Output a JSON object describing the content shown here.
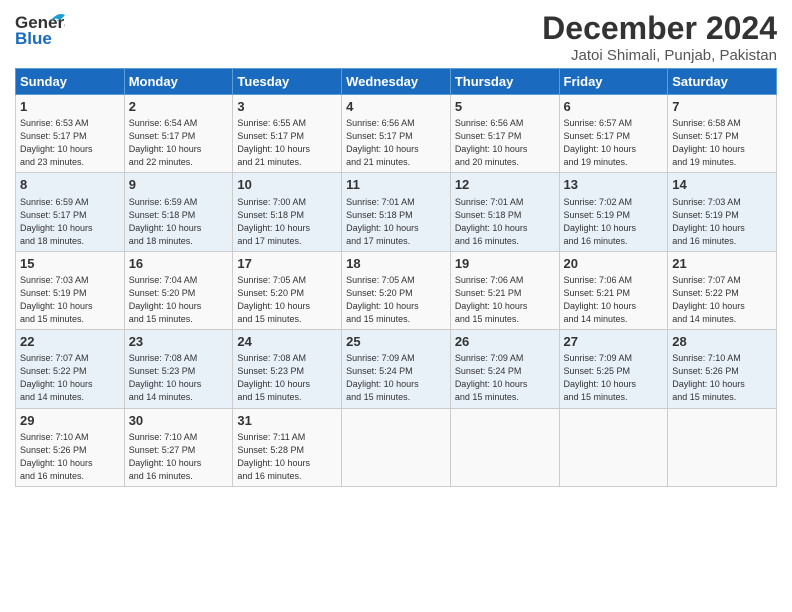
{
  "header": {
    "logo_line1": "General",
    "logo_line2": "Blue",
    "title": "December 2024",
    "subtitle": "Jatoi Shimali, Punjab, Pakistan"
  },
  "columns": [
    "Sunday",
    "Monday",
    "Tuesday",
    "Wednesday",
    "Thursday",
    "Friday",
    "Saturday"
  ],
  "weeks": [
    [
      {
        "day": "1",
        "info": "Sunrise: 6:53 AM\nSunset: 5:17 PM\nDaylight: 10 hours\nand 23 minutes."
      },
      {
        "day": "2",
        "info": "Sunrise: 6:54 AM\nSunset: 5:17 PM\nDaylight: 10 hours\nand 22 minutes."
      },
      {
        "day": "3",
        "info": "Sunrise: 6:55 AM\nSunset: 5:17 PM\nDaylight: 10 hours\nand 21 minutes."
      },
      {
        "day": "4",
        "info": "Sunrise: 6:56 AM\nSunset: 5:17 PM\nDaylight: 10 hours\nand 21 minutes."
      },
      {
        "day": "5",
        "info": "Sunrise: 6:56 AM\nSunset: 5:17 PM\nDaylight: 10 hours\nand 20 minutes."
      },
      {
        "day": "6",
        "info": "Sunrise: 6:57 AM\nSunset: 5:17 PM\nDaylight: 10 hours\nand 19 minutes."
      },
      {
        "day": "7",
        "info": "Sunrise: 6:58 AM\nSunset: 5:17 PM\nDaylight: 10 hours\nand 19 minutes."
      }
    ],
    [
      {
        "day": "8",
        "info": "Sunrise: 6:59 AM\nSunset: 5:17 PM\nDaylight: 10 hours\nand 18 minutes."
      },
      {
        "day": "9",
        "info": "Sunrise: 6:59 AM\nSunset: 5:18 PM\nDaylight: 10 hours\nand 18 minutes."
      },
      {
        "day": "10",
        "info": "Sunrise: 7:00 AM\nSunset: 5:18 PM\nDaylight: 10 hours\nand 17 minutes."
      },
      {
        "day": "11",
        "info": "Sunrise: 7:01 AM\nSunset: 5:18 PM\nDaylight: 10 hours\nand 17 minutes."
      },
      {
        "day": "12",
        "info": "Sunrise: 7:01 AM\nSunset: 5:18 PM\nDaylight: 10 hours\nand 16 minutes."
      },
      {
        "day": "13",
        "info": "Sunrise: 7:02 AM\nSunset: 5:19 PM\nDaylight: 10 hours\nand 16 minutes."
      },
      {
        "day": "14",
        "info": "Sunrise: 7:03 AM\nSunset: 5:19 PM\nDaylight: 10 hours\nand 16 minutes."
      }
    ],
    [
      {
        "day": "15",
        "info": "Sunrise: 7:03 AM\nSunset: 5:19 PM\nDaylight: 10 hours\nand 15 minutes."
      },
      {
        "day": "16",
        "info": "Sunrise: 7:04 AM\nSunset: 5:20 PM\nDaylight: 10 hours\nand 15 minutes."
      },
      {
        "day": "17",
        "info": "Sunrise: 7:05 AM\nSunset: 5:20 PM\nDaylight: 10 hours\nand 15 minutes."
      },
      {
        "day": "18",
        "info": "Sunrise: 7:05 AM\nSunset: 5:20 PM\nDaylight: 10 hours\nand 15 minutes."
      },
      {
        "day": "19",
        "info": "Sunrise: 7:06 AM\nSunset: 5:21 PM\nDaylight: 10 hours\nand 15 minutes."
      },
      {
        "day": "20",
        "info": "Sunrise: 7:06 AM\nSunset: 5:21 PM\nDaylight: 10 hours\nand 14 minutes."
      },
      {
        "day": "21",
        "info": "Sunrise: 7:07 AM\nSunset: 5:22 PM\nDaylight: 10 hours\nand 14 minutes."
      }
    ],
    [
      {
        "day": "22",
        "info": "Sunrise: 7:07 AM\nSunset: 5:22 PM\nDaylight: 10 hours\nand 14 minutes."
      },
      {
        "day": "23",
        "info": "Sunrise: 7:08 AM\nSunset: 5:23 PM\nDaylight: 10 hours\nand 14 minutes."
      },
      {
        "day": "24",
        "info": "Sunrise: 7:08 AM\nSunset: 5:23 PM\nDaylight: 10 hours\nand 15 minutes."
      },
      {
        "day": "25",
        "info": "Sunrise: 7:09 AM\nSunset: 5:24 PM\nDaylight: 10 hours\nand 15 minutes."
      },
      {
        "day": "26",
        "info": "Sunrise: 7:09 AM\nSunset: 5:24 PM\nDaylight: 10 hours\nand 15 minutes."
      },
      {
        "day": "27",
        "info": "Sunrise: 7:09 AM\nSunset: 5:25 PM\nDaylight: 10 hours\nand 15 minutes."
      },
      {
        "day": "28",
        "info": "Sunrise: 7:10 AM\nSunset: 5:26 PM\nDaylight: 10 hours\nand 15 minutes."
      }
    ],
    [
      {
        "day": "29",
        "info": "Sunrise: 7:10 AM\nSunset: 5:26 PM\nDaylight: 10 hours\nand 16 minutes."
      },
      {
        "day": "30",
        "info": "Sunrise: 7:10 AM\nSunset: 5:27 PM\nDaylight: 10 hours\nand 16 minutes."
      },
      {
        "day": "31",
        "info": "Sunrise: 7:11 AM\nSunset: 5:28 PM\nDaylight: 10 hours\nand 16 minutes."
      },
      {
        "day": "",
        "info": ""
      },
      {
        "day": "",
        "info": ""
      },
      {
        "day": "",
        "info": ""
      },
      {
        "day": "",
        "info": ""
      }
    ]
  ]
}
